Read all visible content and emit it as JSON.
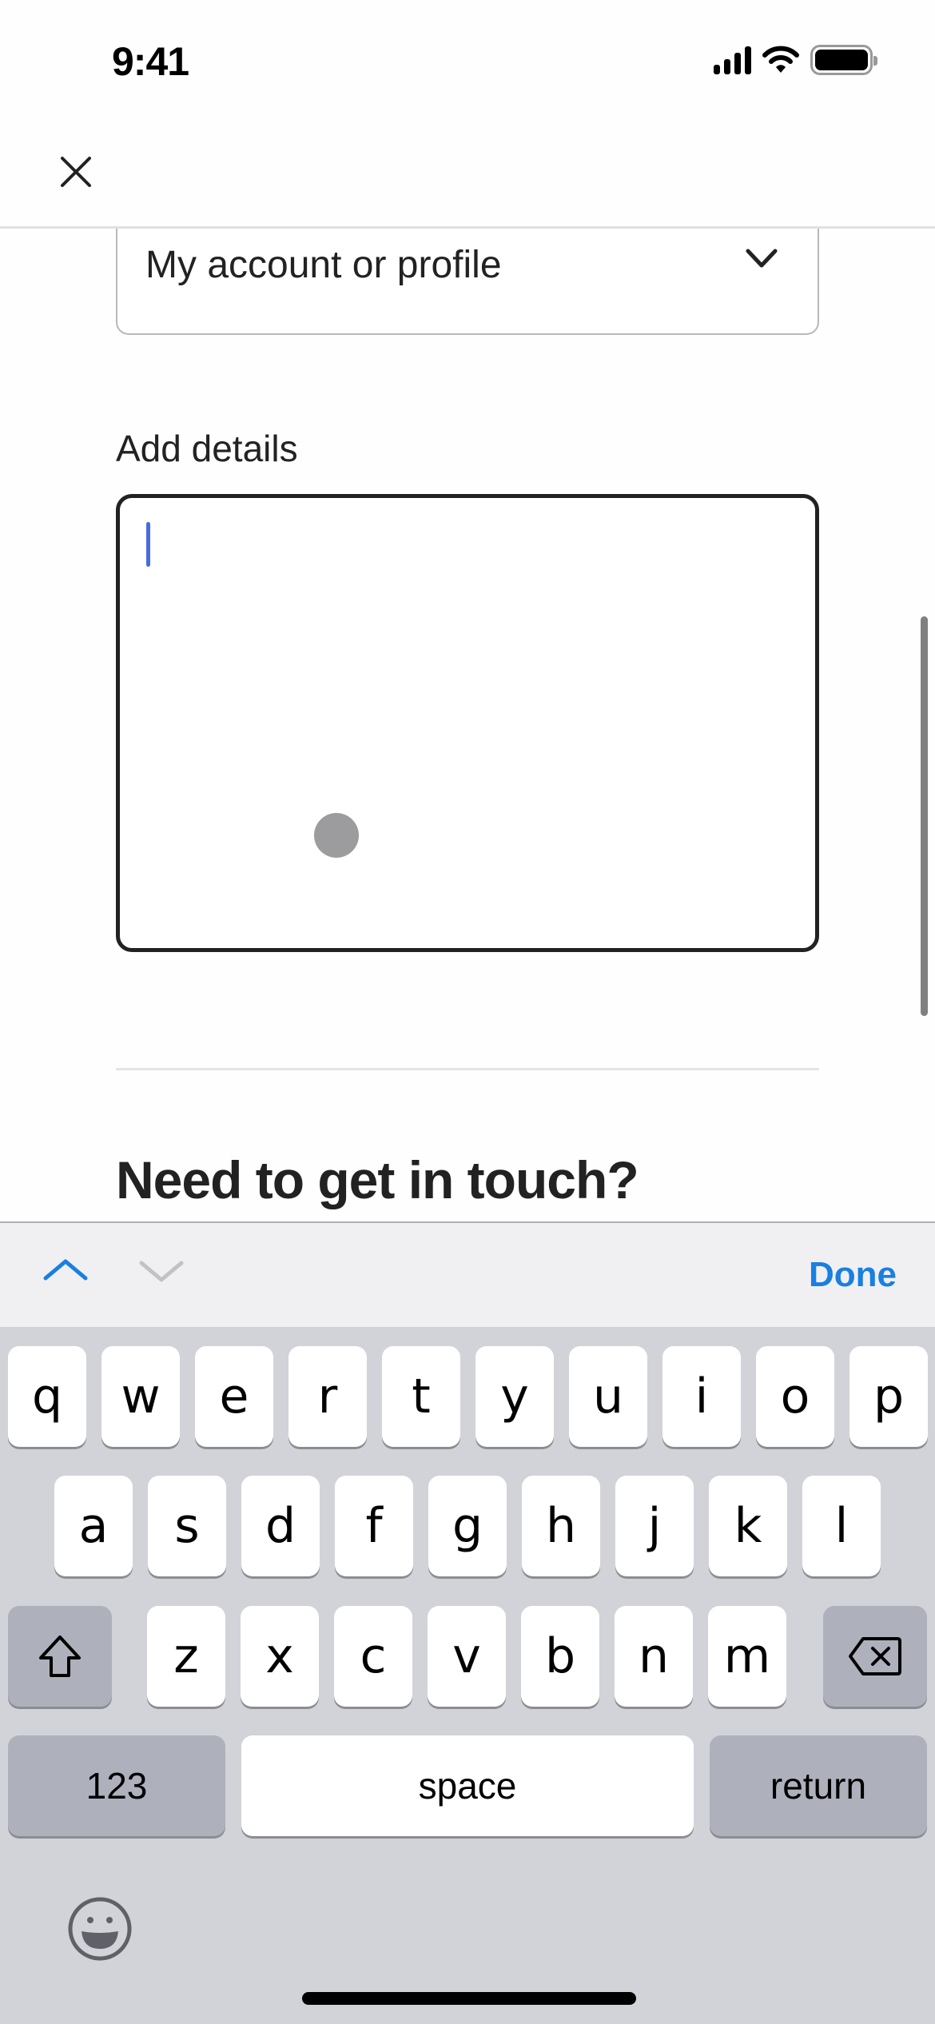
{
  "status_bar": {
    "time": "9:41",
    "icons": [
      "cellular-signal-icon",
      "wifi-icon",
      "battery-icon"
    ]
  },
  "header": {
    "close_icon": "close-icon"
  },
  "form": {
    "topic_select": {
      "value": "My account or profile",
      "icon": "chevron-down-icon"
    },
    "details": {
      "label": "Add details",
      "value": "",
      "focused": true
    },
    "section_title": "Need to get in touch?"
  },
  "accessory_bar": {
    "prev_icon": "chevron-up-icon",
    "next_icon": "chevron-down-icon",
    "done_label": "Done",
    "accent_color": "#1a7fe0"
  },
  "keyboard": {
    "row1": [
      "q",
      "w",
      "e",
      "r",
      "t",
      "y",
      "u",
      "i",
      "o",
      "p"
    ],
    "row2": [
      "a",
      "s",
      "d",
      "f",
      "g",
      "h",
      "j",
      "k",
      "l"
    ],
    "row3": [
      "z",
      "x",
      "c",
      "v",
      "b",
      "n",
      "m"
    ],
    "shift_icon": "shift-icon",
    "delete_icon": "backspace-icon",
    "numbers_label": "123",
    "space_label": "space",
    "return_label": "return",
    "emoji_icon": "emoji-icon"
  }
}
